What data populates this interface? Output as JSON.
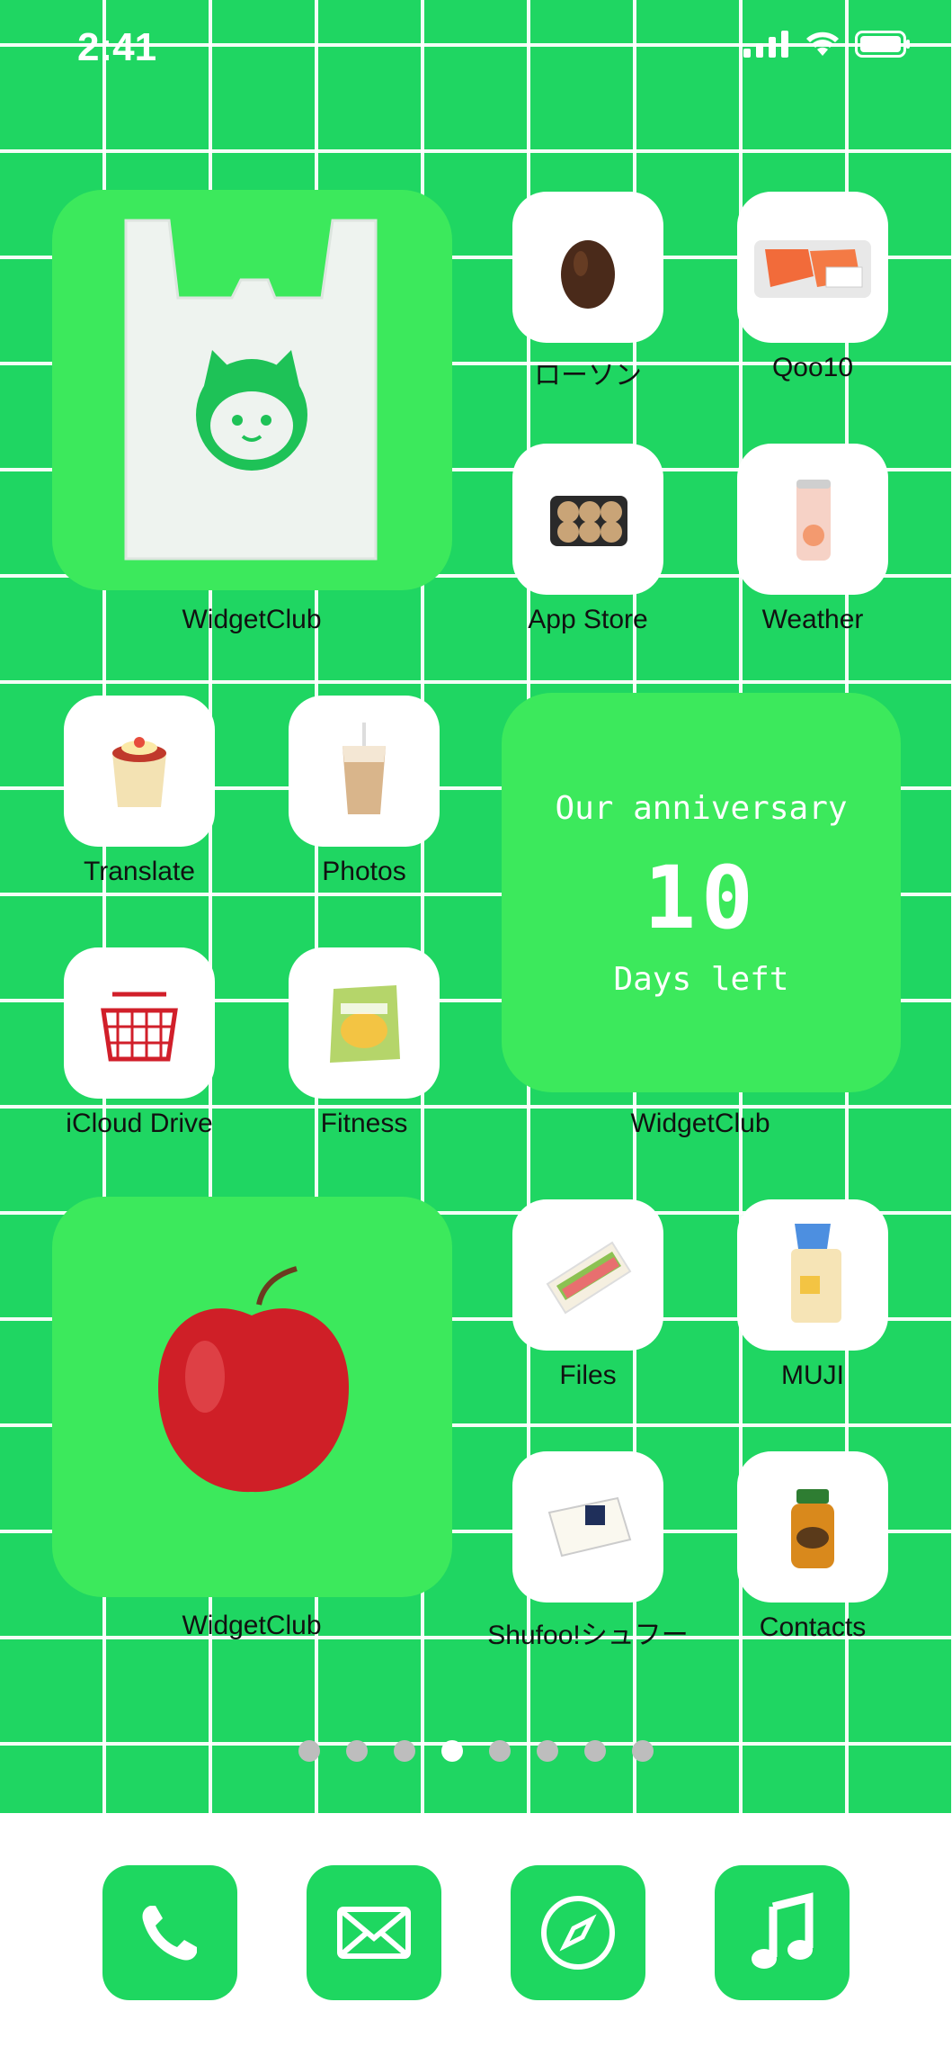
{
  "status_bar": {
    "time": "2:41"
  },
  "widgets": {
    "bag": {
      "label": "WidgetClub"
    },
    "countdown": {
      "title": "Our anniversary",
      "number": "10",
      "subtitle": "Days left",
      "label": "WidgetClub"
    },
    "apple": {
      "label": "WidgetClub"
    }
  },
  "apps": [
    {
      "label": "ローソン",
      "icon": "avocado-icon"
    },
    {
      "label": "Qoo10",
      "icon": "salmon-pack-icon"
    },
    {
      "label": "App Store",
      "icon": "mushroom-pack-icon"
    },
    {
      "label": "Weather",
      "icon": "peach-drink-can-icon"
    },
    {
      "label": "Translate",
      "icon": "pudding-cup-icon"
    },
    {
      "label": "Photos",
      "icon": "iced-coffee-icon"
    },
    {
      "label": "iCloud Drive",
      "icon": "shopping-basket-icon"
    },
    {
      "label": "Fitness",
      "icon": "melon-bread-icon"
    },
    {
      "label": "Files",
      "icon": "sandwich-icon"
    },
    {
      "label": "MUJI",
      "icon": "bread-loaf-icon"
    },
    {
      "label": "Shufoo!シュフー",
      "icon": "tofu-pack-icon"
    },
    {
      "label": "Contacts",
      "icon": "honey-jar-icon"
    }
  ],
  "page_dots": {
    "count": 8,
    "active_index": 3
  },
  "dock": [
    {
      "icon": "phone-icon"
    },
    {
      "icon": "mail-icon"
    },
    {
      "icon": "compass-icon"
    },
    {
      "icon": "music-note-icon"
    }
  ],
  "colors": {
    "wallpaper": "#1fd662",
    "widget": "#3ce95c",
    "dock_icon": "#1ed760"
  }
}
